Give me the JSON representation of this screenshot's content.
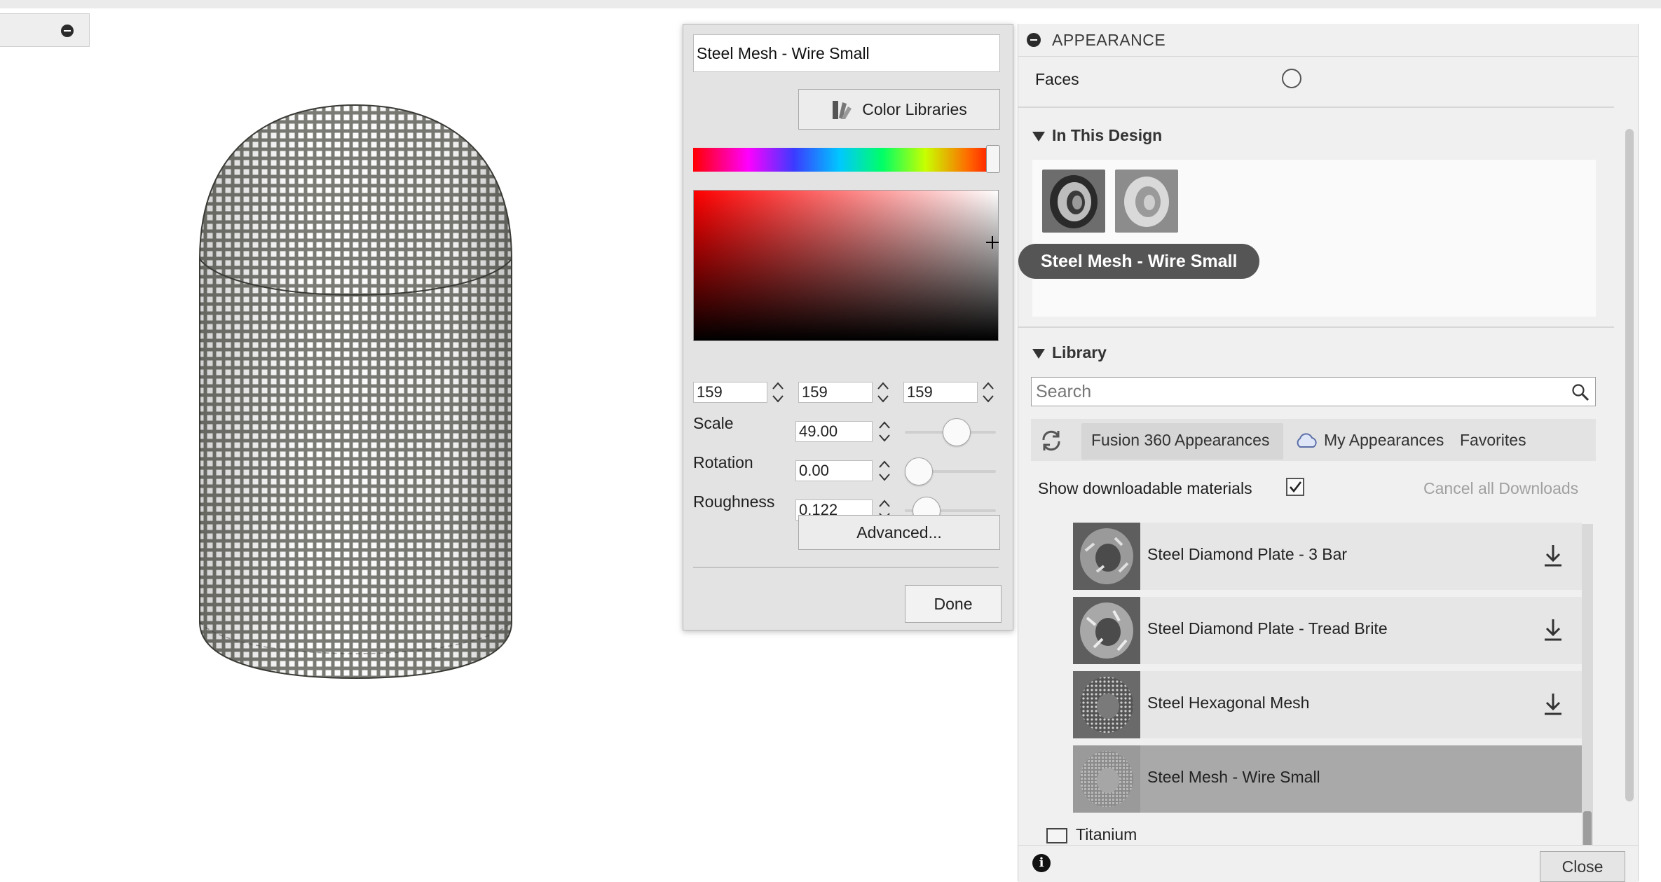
{
  "color_dialog": {
    "material_name": "Steel Mesh - Wire Small",
    "color_libraries_label": "Color Libraries",
    "rgb": [
      "159",
      "159",
      "159"
    ],
    "scale_label": "Scale",
    "scale_value": "49.00",
    "scale_level": 0.6,
    "rotation_label": "Rotation",
    "rotation_value": "0.00",
    "rotation_level": 0.0,
    "roughness_label": "Roughness",
    "roughness_value": "0.122",
    "roughness_level": 0.12,
    "advanced_label": "Advanced...",
    "done_label": "Done"
  },
  "appearance": {
    "title": "APPEARANCE",
    "faces_label": "Faces",
    "in_this_design_title": "In This Design",
    "tooltip": "Steel Mesh - Wire Small",
    "library_title": "Library",
    "search_placeholder": "Search",
    "tabs": [
      "Fusion 360 Appearances",
      "My Appearances",
      "Favorites"
    ],
    "show_downloadable_label": "Show downloadable materials",
    "show_downloadable_checked": true,
    "cancel_downloads_label": "Cancel all Downloads",
    "materials": [
      {
        "name": "Steel Diamond Plate - 3 Bar",
        "downloadable": true
      },
      {
        "name": "Steel Diamond Plate - Tread Brite",
        "downloadable": true
      },
      {
        "name": "Steel Hexagonal Mesh",
        "downloadable": true
      },
      {
        "name": "Steel Mesh - Wire Small",
        "downloadable": false,
        "selected": true
      }
    ],
    "folder_label": "Titanium",
    "close_label": "Close"
  },
  "icons": {
    "panel_collapse": "minus-circle-icon",
    "library_icon": "color-swatch-book-icon",
    "search": "magnifier-icon",
    "refresh": "refresh-icon",
    "cloud": "cloud-icon",
    "download": "download-icon",
    "folder": "folder-icon",
    "info": "info-icon"
  }
}
